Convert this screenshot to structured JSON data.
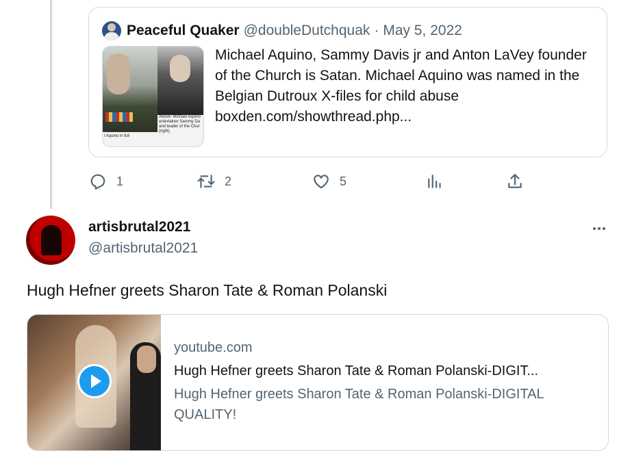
{
  "quoted_tweet": {
    "author_name": "Peaceful Quaker",
    "author_handle": "@doubleDutchquak",
    "separator": "·",
    "date": "May 5, 2022",
    "text": "Michael Aquino, Sammy Davis jr and Anton LaVey founder of the Church is Satan. Michael Aquino was named in the Belgian Dutroux X-files for child abuse boxden.com/showthread.php...",
    "media_caption_right": "Above: Michael Aquino entertainer Sammy Da and leader of the Chur (right).",
    "media_caption_left": "l Aquino in full"
  },
  "actions": {
    "reply_count": "1",
    "retweet_count": "2",
    "like_count": "5",
    "reply_icon": "reply-icon",
    "retweet_icon": "retweet-icon",
    "like_icon": "heart-icon",
    "views_icon": "analytics-icon",
    "share_icon": "share-icon"
  },
  "tweet": {
    "author_name": "artisbrutal2021",
    "author_handle": "@artisbrutal2021",
    "text": "Hugh Hefner greets Sharon Tate & Roman Polanski"
  },
  "link_card": {
    "domain": "youtube.com",
    "title": "Hugh Hefner greets Sharon Tate & Roman Polanski-DIGIT...",
    "description": "Hugh Hefner greets Sharon Tate & Roman Polanski-DIGITAL QUALITY!"
  },
  "colors": {
    "primary_text": "#0f1419",
    "secondary_text": "#536471",
    "border": "#cfd9de",
    "accent": "#1d9bf0"
  }
}
